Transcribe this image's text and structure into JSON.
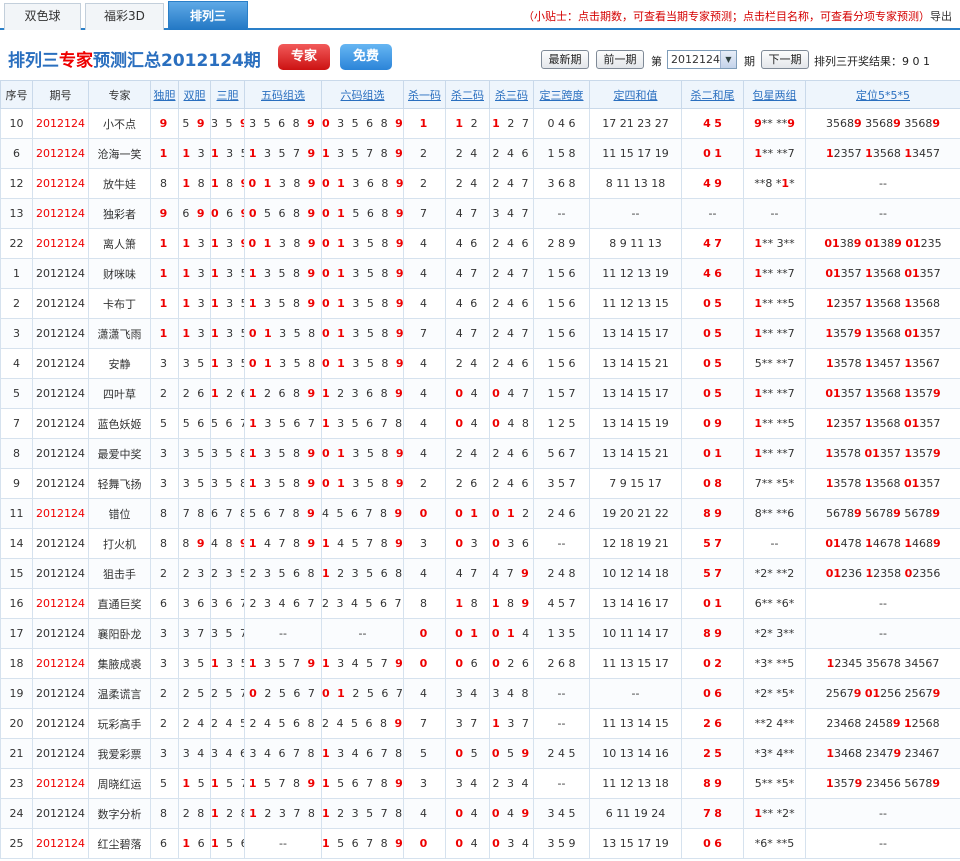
{
  "tabs": [
    {
      "label": "双色球"
    },
    {
      "label": "福彩3D"
    },
    {
      "label": "排列三"
    }
  ],
  "tip": {
    "text": "（小贴士：点击期数，可查看当期专家预测；点击栏目名称，可查看分项专家预测）",
    "tail": "导出"
  },
  "header": {
    "title_prefix": "排列三",
    "title_red": "专家",
    "title_suffix": "预测汇总2012124期",
    "expert_label": "专家",
    "free_label": "免费",
    "latest_label": "最新期",
    "prev_label": "前一期",
    "di_label": "第",
    "period_value": "2012124",
    "qi_label": "期",
    "next_label": "下一期",
    "result_label": "排列三开奖结果：9 0 1"
  },
  "columns": [
    "序号",
    "期号",
    "专家",
    "独胆",
    "双胆",
    "三胆",
    "五码组选",
    "六码组选",
    "杀一码",
    "杀二码",
    "杀三码",
    "定三跨度",
    "定四和值",
    "杀二和尾",
    "包星两组",
    "定位5*5*5"
  ],
  "rows": [
    [
      "10",
      "2012124",
      "小不点",
      "9",
      "5 9",
      "3 5 9",
      "3 5 6 8 9",
      "0 3 5 6 8 9",
      "1",
      "1 2",
      "1 2 7",
      "0 4 6",
      "17 21 23 27",
      "4 5",
      "9** **9",
      "35689 35689 35689"
    ],
    [
      "6",
      "2012124",
      "沧海一笑",
      "1",
      "1 3",
      "1 3 5",
      "1 3 5 7 9",
      "1 3 5 7 8 9",
      "2",
      "2 4",
      "2 4 6",
      "1 5 8",
      "11 15 17 19",
      "0 1",
      "1** **7",
      "12357 13568 13457"
    ],
    [
      "12",
      "2012124",
      "放牛娃",
      "8",
      "1 8",
      "1 8 9",
      "0 1 3 8 9",
      "0 1 3 6 8 9",
      "2",
      "2 4",
      "2 4 7",
      "3 6 8",
      "8 11 13 18",
      "4 9",
      "**8 *1*",
      "--"
    ],
    [
      "13",
      "2012124",
      "独彩者",
      "9",
      "6 9",
      "0 6 9",
      "0 5 6 8 9",
      "0 1 5 6 8 9",
      "7",
      "4 7",
      "3 4 7",
      "--",
      "--",
      "--",
      "--",
      "--"
    ],
    [
      "22",
      "2012124",
      "离人箫",
      "1",
      "1 3",
      "1 3 9",
      "0 1 3 8 9",
      "0 1 3 5 8 9",
      "4",
      "4 6",
      "2 4 6",
      "2 8 9",
      "8 9 11 13",
      "4 7",
      "1** 3**",
      "01389 01389 01235"
    ],
    [
      "1",
      "2012124",
      "财咪味",
      "1",
      "1 3",
      "1 3 5",
      "1 3 5 8 9",
      "0 1 3 5 8 9",
      "4",
      "4 7",
      "2 4 7",
      "1 5 6",
      "11 12 13 19",
      "4 6",
      "1** **7",
      "01357 13568 01357"
    ],
    [
      "2",
      "2012124",
      "卡布丁",
      "1",
      "1 3",
      "1 3 5",
      "1 3 5 8 9",
      "0 1 3 5 8 9",
      "4",
      "4 6",
      "2 4 6",
      "1 5 6",
      "11 12 13 15",
      "0 5",
      "1** **5",
      "12357 13568 13568"
    ],
    [
      "3",
      "2012124",
      "潇潇飞雨",
      "1",
      "1 3",
      "1 3 5",
      "0 1 3 5 8",
      "0 1 3 5 8 9",
      "7",
      "4 7",
      "2 4 7",
      "1 5 6",
      "13 14 15 17",
      "0 5",
      "1** **7",
      "13579 13568 01357"
    ],
    [
      "4",
      "2012124",
      "安静",
      "3",
      "3 5",
      "1 3 5",
      "0 1 3 5 8",
      "0 1 3 5 8 9",
      "4",
      "2 4",
      "2 4 6",
      "1 5 6",
      "13 14 15 21",
      "0 5",
      "5** **7",
      "13578 13457 13567"
    ],
    [
      "5",
      "2012124",
      "四叶草",
      "2",
      "2 6",
      "1 2 6",
      "1 2 6 8 9",
      "1 2 3 6 8 9",
      "4",
      "0 4",
      "0 4 7",
      "1 5 7",
      "13 14 15 17",
      "0 5",
      "1** **7",
      "01357 13568 13579"
    ],
    [
      "7",
      "2012124",
      "蓝色妖姬",
      "5",
      "5 6",
      "5 6 7",
      "1 3 5 6 7",
      "1 3 5 6 7 8",
      "4",
      "0 4",
      "0 4 8",
      "1 2 5",
      "13 14 15 19",
      "0 9",
      "1** **5",
      "12357 13568 01357"
    ],
    [
      "8",
      "2012124",
      "最爱中奖",
      "3",
      "3 5",
      "3 5 8",
      "1 3 5 8 9",
      "0 1 3 5 8 9",
      "4",
      "2 4",
      "2 4 6",
      "5 6 7",
      "13 14 15 21",
      "0 1",
      "1** **7",
      "13578 01357 13579"
    ],
    [
      "9",
      "2012124",
      "轻舞飞扬",
      "3",
      "3 5",
      "3 5 8",
      "1 3 5 8 9",
      "0 1 3 5 8 9",
      "2",
      "2 6",
      "2 4 6",
      "3 5 7",
      "7 9 15 17",
      "0 8",
      "7** *5*",
      "13578 13568 01357"
    ],
    [
      "11",
      "2012124",
      "错位",
      "8",
      "7 8",
      "6 7 8",
      "5 6 7 8 9",
      "4 5 6 7 8 9",
      "0",
      "0 1",
      "0 1 2",
      "2 4 6",
      "19 20 21 22",
      "8 9",
      "8** **6",
      "56789 56789 56789"
    ],
    [
      "14",
      "2012124",
      "打火机",
      "8",
      "8 9",
      "4 8 9",
      "1 4 7 8 9",
      "1 4 5 7 8 9",
      "3",
      "0 3",
      "0 3 6",
      "--",
      "12 18 19 21",
      "5 7",
      "--",
      "01478 14678 14689"
    ],
    [
      "15",
      "2012124",
      "狙击手",
      "2",
      "2 3",
      "2 3 5",
      "2 3 5 6 8",
      "1 2 3 5 6 8",
      "4",
      "4 7",
      "4 7 9",
      "2 4 8",
      "10 12 14 18",
      "5 7",
      "*2* **2",
      "01236 12358 02356"
    ],
    [
      "16",
      "2012124",
      "直通巨奖",
      "6",
      "3 6",
      "3 6 7",
      "2 3 4 6 7",
      "2 3 4 5 6 7",
      "8",
      "1 8",
      "1 8 9",
      "4 5 7",
      "13 14 16 17",
      "0 1",
      "6** *6*",
      "--"
    ],
    [
      "17",
      "2012124",
      "襄阳卧龙",
      "3",
      "3 7",
      "3 5 7",
      "--",
      "--",
      "0",
      "0 1",
      "0 1 4",
      "1 3 5",
      "10 11 14 17",
      "8 9",
      "*2* 3**",
      "--"
    ],
    [
      "18",
      "2012124",
      "集腋成裘",
      "3",
      "3 5",
      "1 3 5",
      "1 3 5 7 9",
      "1 3 4 5 7 9",
      "0",
      "0 6",
      "0 2 6",
      "2 6 8",
      "11 13 15 17",
      "0 2",
      "*3* **5",
      "12345 35678 34567"
    ],
    [
      "19",
      "2012124",
      "温柔谎言",
      "2",
      "2 5",
      "2 5 7",
      "0 2 5 6 7",
      "0 1 2 5 6 7",
      "4",
      "3 4",
      "3 4 8",
      "--",
      "--",
      "0 6",
      "*2* *5*",
      "25679 01256 25679"
    ],
    [
      "20",
      "2012124",
      "玩彩高手",
      "2",
      "2 4",
      "2 4 5",
      "2 4 5 6 8",
      "2 4 5 6 8 9",
      "7",
      "3 7",
      "1 3 7",
      "--",
      "11 13 14 15",
      "2 6",
      "**2 4**",
      "23468 24589 12568"
    ],
    [
      "21",
      "2012124",
      "我爱彩票",
      "3",
      "3 4",
      "3 4 6",
      "3 4 6 7 8",
      "1 3 4 6 7 8",
      "5",
      "0 5",
      "0 5 9",
      "2 4 5",
      "10 13 14 16",
      "2 5",
      "*3* 4**",
      "13468 23479 23467"
    ],
    [
      "23",
      "2012124",
      "周晓红运",
      "5",
      "1 5",
      "1 5 7",
      "1 5 7 8 9",
      "1 5 6 7 8 9",
      "3",
      "3 4",
      "2 3 4",
      "--",
      "11 12 13 18",
      "8 9",
      "5** *5*",
      "13579 23456 56789"
    ],
    [
      "24",
      "2012124",
      "数字分析",
      "8",
      "2 8",
      "1 2 8",
      "1 2 3 7 8",
      "1 2 3 5 7 8",
      "4",
      "0 4",
      "0 4 9",
      "3 4 5",
      "6 11 19 24",
      "7 8",
      "1** *2*",
      "--"
    ],
    [
      "25",
      "2012124",
      "红尘碧落",
      "6",
      "1 6",
      "1 5 6",
      "--",
      "1 5 6 7 8 9",
      "0",
      "0 4",
      "0 3 4",
      "3 5 9",
      "13 15 17 19",
      "0 6",
      "*6* **5",
      "--"
    ]
  ],
  "red_period_rows": [
    0,
    1,
    2,
    3,
    4,
    13,
    16,
    18,
    22,
    24
  ]
}
